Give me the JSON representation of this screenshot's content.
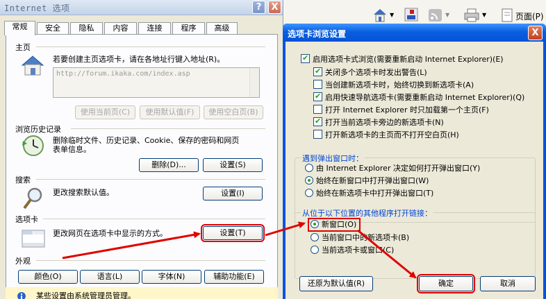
{
  "internet_options": {
    "title": "Internet 选项",
    "help_label": "?",
    "close_label": "X",
    "tabs": [
      {
        "label": "常规"
      },
      {
        "label": "安全"
      },
      {
        "label": "隐私"
      },
      {
        "label": "内容"
      },
      {
        "label": "连接"
      },
      {
        "label": "程序"
      },
      {
        "label": "高级"
      }
    ],
    "homepage": {
      "section": "主页",
      "description": "若要创建主页选项卡，请在各地址行键入地址(R)。",
      "url_value": "http://forum.ikaka.com/index.asp",
      "use_current": "使用当前页(C)",
      "use_default": "使用默认值(F)",
      "use_blank": "使用空白页(B)"
    },
    "history": {
      "section": "浏览历史记录",
      "description_line1": "删除临时文件、历史记录、Cookie、保存的密码和网页",
      "description_line2": "表单信息。",
      "delete_button": "删除(D)...",
      "settings_button": "设置(S)"
    },
    "search": {
      "section": "搜索",
      "description": "更改搜索默认值。",
      "settings_button": "设置(I)"
    },
    "tabs_section": {
      "section": "选项卡",
      "description": "更改网页在选项卡中显示的方式。",
      "settings_button": "设置(T)"
    },
    "appearance": {
      "section": "外观",
      "colors": "颜色(O)",
      "languages": "语言(L)",
      "fonts": "字体(N)",
      "accessibility": "辅助功能(E)"
    },
    "admin_note": "某些设置由系统管理员管理。"
  },
  "browser_toolbar": {
    "page_label": "页面(P)"
  },
  "tab_settings_dialog": {
    "title": "选项卡浏览设置",
    "close_label": "X",
    "enable_tabbed": {
      "label": "启用选项卡式浏览(需要重新启动 Internet Explorer)(E)",
      "checked": true
    },
    "options": [
      {
        "label": "关闭多个选项卡时发出警告(L)",
        "checked": true
      },
      {
        "label": "当创建新选项卡时，始终切换到新选项卡(A)",
        "checked": false
      },
      {
        "label": "启用快速导航选项卡(需要重新启动 Internet Explorer)(Q)",
        "checked": true
      },
      {
        "label": "打开 Internet Explorer 时只加载第一个主页(F)",
        "checked": false
      },
      {
        "label": "打开当前选项卡旁边的新选项卡(N)",
        "checked": true
      },
      {
        "label": "打开新选项卡的主页而不打开空白页(H)",
        "checked": false
      }
    ],
    "popup_group": {
      "title": "遇到弹出窗口时：",
      "options": [
        {
          "label": "由 Internet Explorer 决定如何打开弹出窗口(Y)",
          "selected": false
        },
        {
          "label": "始终在新窗口中打开弹出窗口(W)",
          "selected": true
        },
        {
          "label": "始终在新选项卡中打开弹出窗口(T)",
          "selected": false
        }
      ]
    },
    "links_group": {
      "title": "从位于以下位置的其他程序打开链接：",
      "options": [
        {
          "label": "新窗口(O)",
          "selected": true
        },
        {
          "label": "当前窗口中的新选项卡(B)",
          "selected": false
        },
        {
          "label": "当前选项卡或窗口(C)",
          "selected": false
        }
      ]
    },
    "restore_defaults": "还原为默认值(R)",
    "ok": "确定",
    "cancel": "取消"
  },
  "colors": {
    "annotation_red": "#e00000",
    "dialog_titlebar_blue": "#0a5fe0",
    "group_title_blue": "#0046d5",
    "check_green": "#21a121"
  },
  "icons": [
    "home-icon",
    "history-clock-icon",
    "search-magnifier-icon",
    "tabs-window-icon",
    "info-icon",
    "home-toolbar-icon",
    "rss-icon",
    "print-icon",
    "page-icon"
  ]
}
